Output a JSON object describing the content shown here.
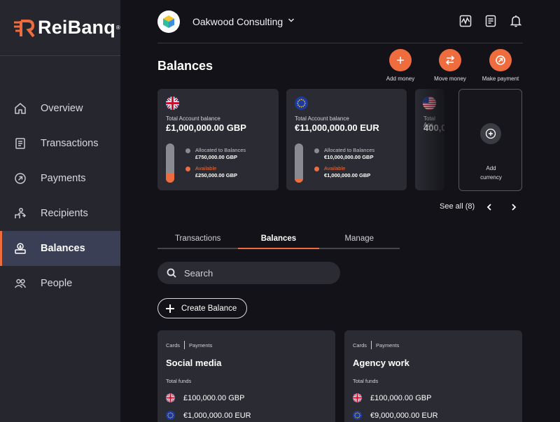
{
  "brand": {
    "name": "ReiBanq",
    "reg": "®",
    "accent": "#ef6c3f"
  },
  "sidebar": {
    "items": [
      {
        "label": "Overview",
        "icon": "home-icon"
      },
      {
        "label": "Transactions",
        "icon": "document-icon"
      },
      {
        "label": "Payments",
        "icon": "payment-arrow-icon"
      },
      {
        "label": "Recipients",
        "icon": "recipients-icon"
      },
      {
        "label": "Balances",
        "icon": "balances-icon",
        "active": true
      },
      {
        "label": "People",
        "icon": "people-icon"
      }
    ]
  },
  "header": {
    "org_name": "Oakwood Consulting",
    "icons": [
      "activity-icon",
      "report-icon",
      "notification-bell-icon"
    ]
  },
  "page": {
    "title": "Balances",
    "actions": [
      {
        "label": "Add money",
        "icon": "plus-icon"
      },
      {
        "label": "Move money",
        "icon": "swap-arrows-icon"
      },
      {
        "label": "Make payment",
        "icon": "send-arrow-icon"
      }
    ]
  },
  "balance_cards": [
    {
      "flag": "uk-flag-icon",
      "label": "Total Account balance",
      "amount": "£1,000,000.00 GBP",
      "allocated_label": "Allocated to Balances",
      "allocated_value": "£750,000.00 GBP",
      "available_label": "Available",
      "available_value": "£250,000.00 GBP",
      "available_fraction": 0.25
    },
    {
      "flag": "eu-flag-icon",
      "label": "Total Account balance",
      "amount": "€11,000,000.00 EUR",
      "allocated_label": "Allocated to Balances",
      "allocated_value": "€10,000,000.00 GBP",
      "available_label": "Available",
      "available_value": "€1,000,000.00 GBP",
      "available_fraction": 0.09
    },
    {
      "flag": "us-flag-icon",
      "label": "Total Acc",
      "amount": "400,0"
    }
  ],
  "add_currency": {
    "line1": "Add",
    "line2": "currency"
  },
  "see_all": "See all (8)",
  "tabs": [
    {
      "label": "Transactions"
    },
    {
      "label": "Balances",
      "active": true
    },
    {
      "label": "Manage"
    }
  ],
  "search": {
    "placeholder": "Search",
    "value": ""
  },
  "create_balance": "Create Balance",
  "wallets": [
    {
      "tag1": "Cards",
      "tag2": "Payments",
      "title": "Social media",
      "funds_label": "Total funds",
      "rows": [
        {
          "flag": "uk-flag-icon",
          "value": "£100,000.00 GBP"
        },
        {
          "flag": "eu-flag-icon",
          "value": "€1,000,000.00 EUR"
        }
      ]
    },
    {
      "tag1": "Cards",
      "tag2": "Payments",
      "title": "Agency work",
      "funds_label": "Total funds",
      "rows": [
        {
          "flag": "uk-flag-icon",
          "value": "£100,000.00 GBP"
        },
        {
          "flag": "eu-flag-icon",
          "value": "€9,000,000.00 EUR"
        }
      ]
    }
  ],
  "colors": {
    "available": "#ef6c3f",
    "allocated": "#8a8b92"
  }
}
